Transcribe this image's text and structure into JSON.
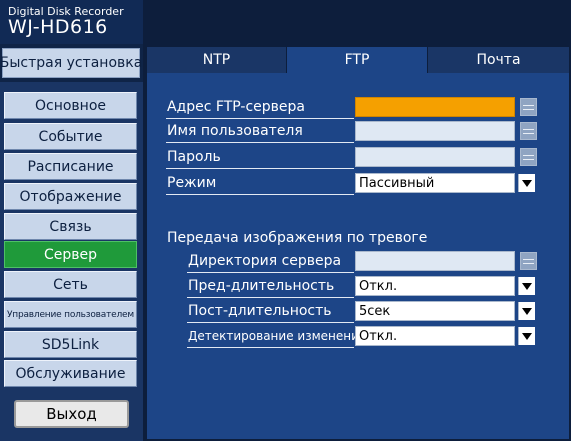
{
  "header": {
    "model_line": "Digital Disk Recorder",
    "model_name": "WJ-HD616"
  },
  "quick_setup": "Быстрая установка",
  "menu": {
    "items": [
      {
        "label": "Основное"
      },
      {
        "label": "Событие"
      },
      {
        "label": "Расписание"
      },
      {
        "label": "Отображение"
      },
      {
        "label": "Связь"
      },
      {
        "label": "Сервер",
        "active": true
      },
      {
        "label": "Сеть"
      },
      {
        "label": "Управление пользователем"
      },
      {
        "label": "SD5Link"
      },
      {
        "label": "Обслуживание"
      }
    ],
    "exit": "Выход"
  },
  "tabs": [
    {
      "label": "NTP"
    },
    {
      "label": "FTP",
      "active": true
    },
    {
      "label": "Почта"
    }
  ],
  "ftp": {
    "server_address": {
      "label": "Адрес FTP-сервера",
      "value": ""
    },
    "username": {
      "label": "Имя пользователя",
      "value": ""
    },
    "password": {
      "label": "Пароль",
      "value": ""
    },
    "mode": {
      "label": "Режим",
      "value": "Пассивный"
    }
  },
  "alarm": {
    "title": "Передача изображения по тревоге",
    "server_directory": {
      "label": "Директория сервера",
      "value": ""
    },
    "pre_duration": {
      "label": "Пред-длительность",
      "value": "Откл."
    },
    "post_duration": {
      "label": "Пост-длительность",
      "value": "5сек"
    },
    "change_detection": {
      "label": "Детектирование изменения",
      "value": "Откл."
    }
  },
  "colors": {
    "background": "#0d1e3c",
    "panel": "#1d4587",
    "active_menu": "#1f9a3a",
    "highlight_field": "#f5a000"
  }
}
